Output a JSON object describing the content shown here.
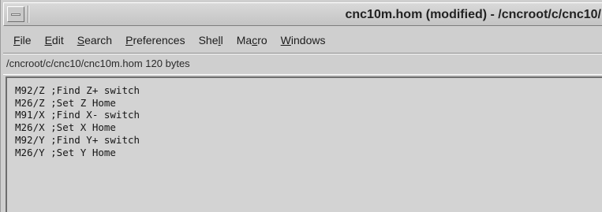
{
  "window": {
    "title": "cnc10m.hom (modified) - /cncroot/c/cnc10/"
  },
  "menubar": {
    "items": [
      {
        "pre": "",
        "mn": "F",
        "post": "ile"
      },
      {
        "pre": "",
        "mn": "E",
        "post": "dit"
      },
      {
        "pre": "",
        "mn": "S",
        "post": "earch"
      },
      {
        "pre": "",
        "mn": "P",
        "post": "references"
      },
      {
        "pre": "She",
        "mn": "l",
        "post": "l"
      },
      {
        "pre": "Ma",
        "mn": "c",
        "post": "ro"
      },
      {
        "pre": "",
        "mn": "W",
        "post": "indows"
      }
    ]
  },
  "status": {
    "text": "/cncroot/c/cnc10/cnc10m.hom 120 bytes"
  },
  "editor": {
    "lines": [
      "M92/Z ;Find Z+ switch",
      "M26/Z ;Set Z Home",
      "M91/X ;Find X- switch",
      "M26/X ;Set X Home",
      "M92/Y ;Find Y+ switch",
      "M26/Y ;Set Y Home"
    ]
  }
}
